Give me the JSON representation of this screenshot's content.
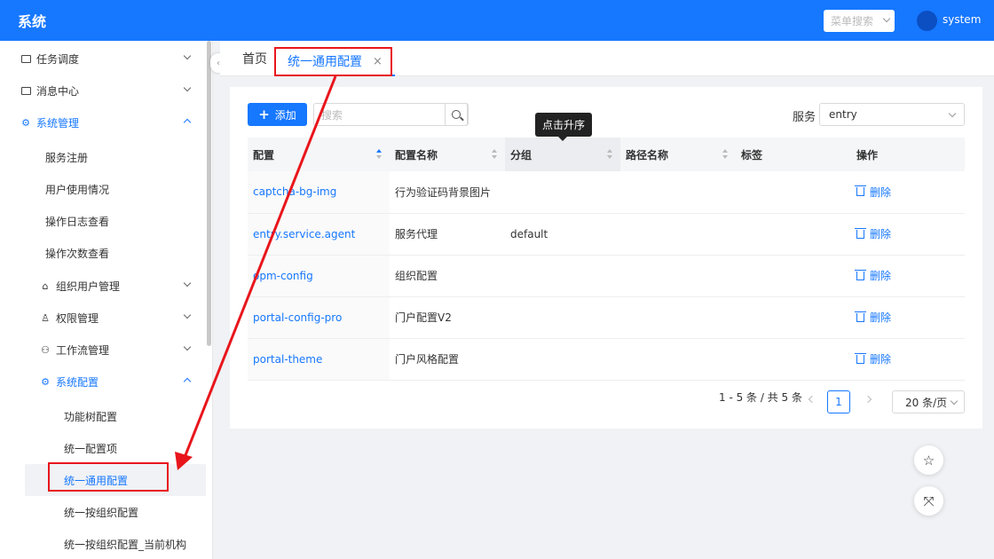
{
  "header": {
    "logo": "系统",
    "menu_search_placeholder": "菜单搜索",
    "username": "system"
  },
  "sidebar": {
    "items": [
      {
        "label": "任务调度",
        "icon": "folder-icon"
      },
      {
        "label": "消息中心",
        "icon": "folder-icon"
      },
      {
        "label": "系统管理",
        "icon": "gear-icon"
      },
      {
        "label": "服务注册"
      },
      {
        "label": "用户使用情况"
      },
      {
        "label": "操作日志查看"
      },
      {
        "label": "操作次数查看"
      },
      {
        "label": "组织用户管理",
        "icon": "bank-icon"
      },
      {
        "label": "权限管理",
        "icon": "user-icon"
      },
      {
        "label": "工作流管理",
        "icon": "cluster-icon"
      },
      {
        "label": "系统配置",
        "icon": "gear-icon"
      },
      {
        "label": "功能树配置"
      },
      {
        "label": "统一配置项"
      },
      {
        "label": "统一通用配置"
      },
      {
        "label": "统一按组织配置"
      },
      {
        "label": "统一按组织配置_当前机构"
      }
    ]
  },
  "tabs": {
    "home": "首页",
    "active": "统一通用配置",
    "close": "×"
  },
  "toolbar": {
    "add_label": "添加",
    "search_placeholder": "搜索",
    "service_label": "服务",
    "service_value": "entry"
  },
  "tooltip": "点击升序",
  "table": {
    "headers": [
      "配置",
      "配置名称",
      "分组",
      "路径名称",
      "标签",
      "操作"
    ],
    "rows": [
      {
        "config": "captcha-bg-img",
        "name": "行为验证码背景图片",
        "group": "",
        "path": "",
        "tag": "",
        "action": "删除"
      },
      {
        "config": "entry.service.agent",
        "name": "服务代理",
        "group": "default",
        "path": "",
        "tag": "",
        "action": "删除"
      },
      {
        "config": "opm-config",
        "name": "组织配置",
        "group": "",
        "path": "",
        "tag": "",
        "action": "删除"
      },
      {
        "config": "portal-config-pro",
        "name": "门户配置V2",
        "group": "",
        "path": "",
        "tag": "",
        "action": "删除"
      },
      {
        "config": "portal-theme",
        "name": "门户风格配置",
        "group": "",
        "path": "",
        "tag": "",
        "action": "删除"
      }
    ]
  },
  "pagination": {
    "summary": "1 - 5 条 / 共 5 条",
    "current_page": "1",
    "page_size": "20 条/页"
  },
  "colors": {
    "primary": "#1677ff",
    "annotation_red": "#e8161c"
  }
}
